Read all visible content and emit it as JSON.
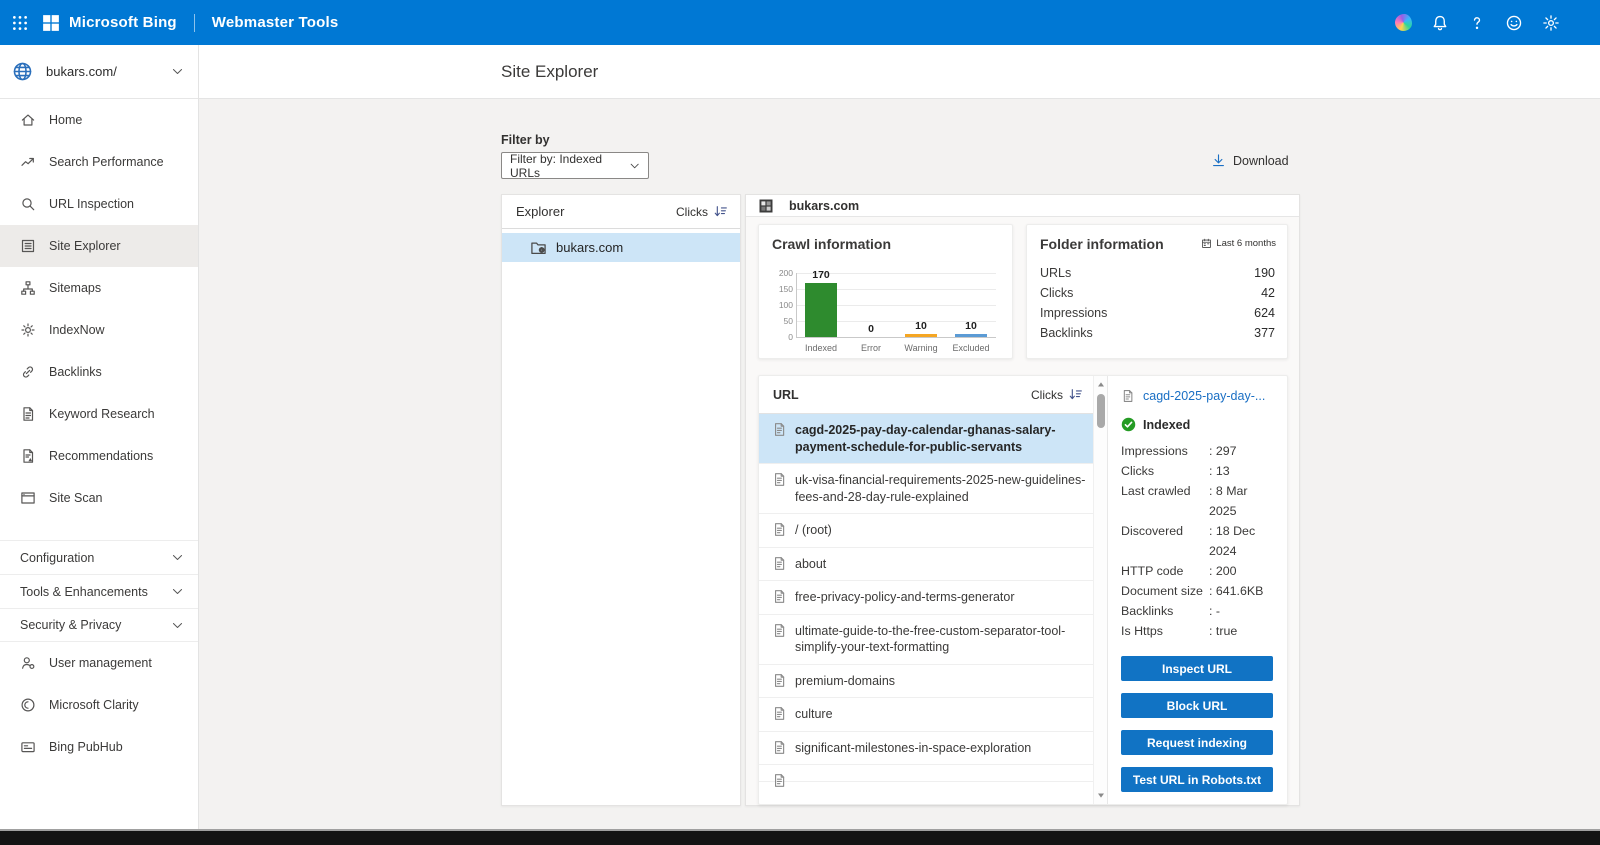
{
  "topbar": {
    "brand": "Microsoft Bing",
    "product": "Webmaster Tools",
    "left_icons": [
      "waffle-icon",
      "microsoft-logo"
    ],
    "right_icons": [
      "copilot",
      "notifications",
      "help",
      "feedback",
      "settings"
    ]
  },
  "site_selector": {
    "site": "bukars.com/",
    "globe_icon": "globe-icon",
    "chevron_icon": "chevron-down-icon"
  },
  "sidebar": {
    "items": [
      {
        "label": "Home",
        "icon": "home",
        "selected": false
      },
      {
        "label": "Search Performance",
        "icon": "trend",
        "selected": false
      },
      {
        "label": "URL Inspection",
        "icon": "search",
        "selected": false
      },
      {
        "label": "Site Explorer",
        "icon": "list",
        "selected": true
      },
      {
        "label": "Sitemaps",
        "icon": "sitemap",
        "selected": false
      },
      {
        "label": "IndexNow",
        "icon": "gearsm",
        "selected": false
      },
      {
        "label": "Backlinks",
        "icon": "link",
        "selected": false
      },
      {
        "label": "Keyword Research",
        "icon": "docline",
        "selected": false
      },
      {
        "label": "Recommendations",
        "icon": "docwarn",
        "selected": false
      },
      {
        "label": "Site Scan",
        "icon": "browser",
        "selected": false
      }
    ],
    "sections": [
      {
        "label": "Configuration"
      },
      {
        "label": "Tools & Enhancements"
      },
      {
        "label": "Security & Privacy"
      }
    ],
    "footer_items": [
      {
        "label": "User management",
        "icon": "user"
      },
      {
        "label": "Microsoft Clarity",
        "icon": "clarity"
      },
      {
        "label": "Bing PubHub",
        "icon": "pubhub"
      }
    ]
  },
  "page": {
    "title": "Site Explorer"
  },
  "filter": {
    "label": "Filter by",
    "value": "Filter by: Indexed URLs"
  },
  "download": {
    "label": "Download"
  },
  "explorer_panel": {
    "title": "Explorer",
    "sort_label": "Clicks",
    "tree": [
      {
        "label": "bukars.com",
        "selected": true
      }
    ]
  },
  "main_panel": {
    "site": "bukars.com",
    "crawl_card": {
      "title": "Crawl information"
    },
    "folder_card": {
      "title": "Folder information",
      "period": "Last 6 months",
      "stats": [
        {
          "label": "URLs",
          "value": "190"
        },
        {
          "label": "Clicks",
          "value": "42"
        },
        {
          "label": "Impressions",
          "value": "624"
        },
        {
          "label": "Backlinks",
          "value": "377"
        }
      ]
    },
    "url_list": {
      "header": "URL",
      "sort_label": "Clicks",
      "rows": [
        {
          "label": "cagd-2025-pay-day-calendar-ghanas-salary-payment-schedule-for-public-servants",
          "selected": true
        },
        {
          "label": "uk-visa-financial-requirements-2025-new-guidelines-fees-and-28-day-rule-explained",
          "selected": false
        },
        {
          "label": "/ (root)",
          "selected": false
        },
        {
          "label": "about",
          "selected": false
        },
        {
          "label": "free-privacy-policy-and-terms-generator",
          "selected": false
        },
        {
          "label": "ultimate-guide-to-the-free-custom-separator-tool-simplify-your-text-formatting",
          "selected": false
        },
        {
          "label": "premium-domains",
          "selected": false
        },
        {
          "label": "culture",
          "selected": false
        },
        {
          "label": "significant-milestones-in-space-exploration",
          "selected": false
        }
      ]
    },
    "detail": {
      "title": "cagd-2025-pay-day-...",
      "status": "Indexed",
      "properties": [
        {
          "label": "Impressions",
          "value": "297"
        },
        {
          "label": "Clicks",
          "value": "13"
        },
        {
          "label": "Last crawled",
          "value": "8 Mar 2025"
        },
        {
          "label": "Discovered",
          "value": "18 Dec 2024"
        },
        {
          "label": "HTTP code",
          "value": "200"
        },
        {
          "label": "Document size",
          "value": "641.6KB"
        },
        {
          "label": "Backlinks",
          "value": "-"
        },
        {
          "label": "Is Https",
          "value": "true"
        }
      ],
      "buttons": [
        "Inspect URL",
        "Block URL",
        "Request indexing",
        "Test URL in Robots.txt"
      ]
    }
  },
  "chart_data": {
    "type": "bar",
    "title": "Crawl information",
    "categories": [
      "Indexed",
      "Error",
      "Warning",
      "Excluded"
    ],
    "values": [
      170,
      0,
      10,
      10
    ],
    "labels": [
      "170",
      "0",
      "10",
      "10"
    ],
    "colors": [
      "#2e8b2e",
      "#7a7a7a",
      "#f5a623",
      "#5b9bd5"
    ],
    "xlabel": "",
    "ylabel": "",
    "ylim": [
      0,
      200
    ],
    "yticks": [
      0,
      50,
      100,
      150,
      200
    ],
    "grid": true,
    "legend": false
  },
  "colors": {
    "topbar": "#0078d4",
    "accent_button": "#1173c4",
    "link": "#1a6fc4",
    "selected_row": "#cde5f7",
    "indexed_green": "#2e8b2e",
    "warning_orange": "#f5a623",
    "excluded_blue": "#5b9bd5",
    "status_green": "#259b24"
  }
}
